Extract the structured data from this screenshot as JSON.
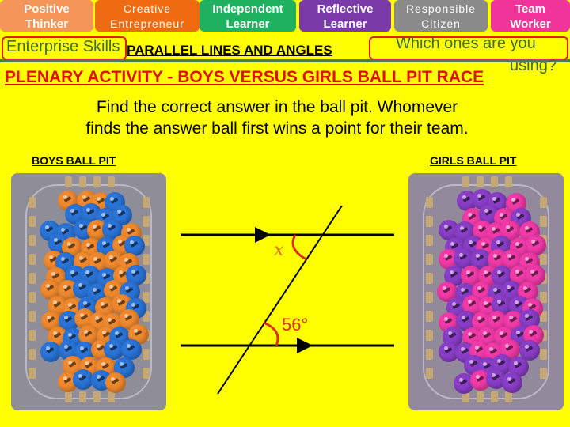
{
  "skills": [
    {
      "id": "positive",
      "line1": "Positive",
      "line2": "Thinker",
      "color": "#f4955a"
    },
    {
      "id": "creative",
      "line1": "Creative",
      "line2": "Entrepreneur",
      "color": "#ee6b12"
    },
    {
      "id": "independent",
      "line1": "Independent",
      "line2": "Learner",
      "color": "#1fb060"
    },
    {
      "id": "reflective",
      "line1": "Reflective",
      "line2": "Learner",
      "color": "#7a3aa8"
    },
    {
      "id": "responsible",
      "line1": "Responsible",
      "line2": "Citizen",
      "color": "#8a8a8a"
    },
    {
      "id": "team",
      "line1": "Team",
      "line2": "Worker",
      "color": "#f0359a"
    }
  ],
  "header": {
    "enterprise_skills": "Enterprise Skills",
    "title": "PARALLEL LINES AND ANGLES",
    "question_line1": "Which ones are you",
    "question_line2": "using?"
  },
  "activity": {
    "heading": "PLENARY ACTIVITY - BOYS VERSUS GIRLS BALL PIT RACE",
    "instruction_line1": "Find the correct answer in the ball pit. Whomever",
    "instruction_line2": "finds the answer ball first wins a point for their team."
  },
  "ball_pits": {
    "boys": {
      "label": "BOYS BALL PIT",
      "colors": [
        "#f0892e",
        "#2a74d8"
      ]
    },
    "girls": {
      "label": "GIRLS BALL PIT",
      "colors": [
        "#f03aa8",
        "#8a3ec8"
      ]
    }
  },
  "diagram": {
    "unknown_angle_label": "x",
    "given_angle_label": "56°",
    "given_angle_degrees": 56,
    "line_color": "#000000",
    "angle_mark_color": "#d9301e"
  }
}
